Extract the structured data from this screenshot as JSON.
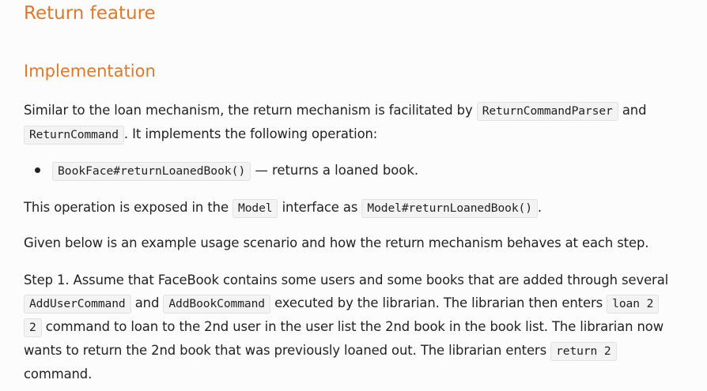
{
  "headings": {
    "section": "Return feature",
    "subsection": "Implementation"
  },
  "intro": {
    "line1_text": "Similar to the loan mechanism, the return mechanism is facilitated by ",
    "code_parser": "ReturnCommandParser",
    "line1_end": " and",
    "code_command": "ReturnCommand",
    "line2_text": ". It implements the following operation:"
  },
  "bullet": {
    "code": "BookFace#returnLoanedBook()",
    "text": " — returns a loaned book."
  },
  "exposed": {
    "text1": "This operation is exposed in the ",
    "code_model": "Model",
    "text2": " interface as ",
    "code_method": "Model#returnLoanedBook()",
    "text3": "."
  },
  "scenario": {
    "text": "Given below is an example usage scenario and how the return mechanism behaves at each step."
  },
  "step1": {
    "line1": "Step 1. Assume that FaceBook contains some users and some books that are added through several",
    "code_adduser": "AddUserCommand",
    "and": " and ",
    "code_addbook": "AddBookCommand",
    "line2_text": " executed by the librarian. The librarian then enters ",
    "code_loan_a": "loan 2",
    "code_loan_b": "2",
    "line3_text": " command to loan to the 2nd user in the user list the 2nd book in the book list. The librarian now",
    "line4_text": "wants to return the 2nd book that was previously loaned out. The librarian enters ",
    "code_return": "return 2",
    "line5_text": "command."
  }
}
